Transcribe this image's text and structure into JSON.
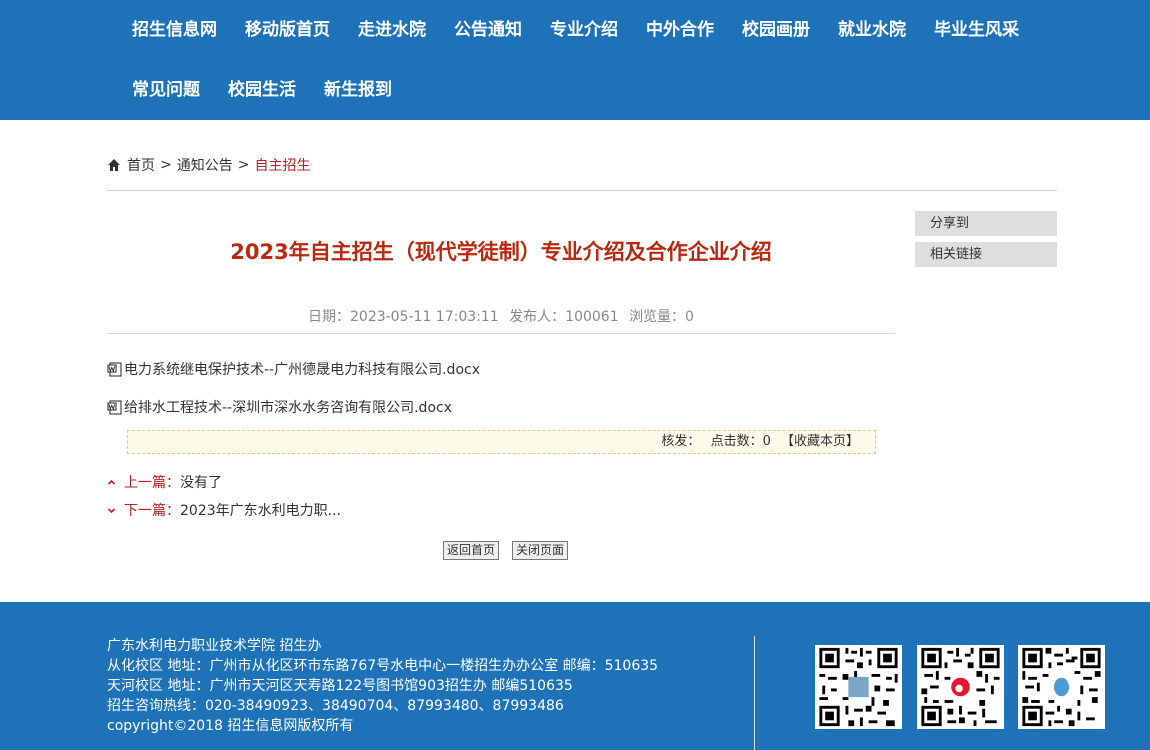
{
  "nav": {
    "row1": [
      "招生信息网",
      "移动版首页",
      "走进水院",
      "公告通知",
      "专业介绍",
      "中外合作",
      "校园画册",
      "就业水院",
      "毕业生风采"
    ],
    "row2": [
      "常见问题",
      "校园生活",
      "新生报到"
    ]
  },
  "breadcrumb": {
    "home": "首页",
    "sep1": ">",
    "section": "通知公告",
    "sep2": ">",
    "current": "自主招生"
  },
  "sidebar": {
    "share": "分享到",
    "links": "相关链接"
  },
  "article": {
    "title": "2023年自主招生（现代学徒制）专业介绍及合作企业介绍",
    "date": "日期：2023-05-11 17:03:11",
    "publisher": "发布人：100061",
    "views": "浏览量：0",
    "attachments": [
      "电力系统继电保护技术--广州德晟电力科技有限公司.docx",
      "给排水工程技术--深圳市深水水务咨询有限公司.docx"
    ],
    "info": {
      "approve": "核发：",
      "clicks": "点击数：0",
      "favorite": "【收藏本页】"
    },
    "prev": {
      "label": "上一篇：",
      "text": "没有了"
    },
    "next": {
      "label": "下一篇：",
      "text": "2023年广东水利电力职..."
    },
    "buttons": {
      "back": "返回首页",
      "close": "关闭页面"
    }
  },
  "footer": {
    "lines": [
      "广东水利电力职业技术学院 招生办",
      "从化校区 地址：广州市从化区环市东路767号水电中心一楼招生办办公室 邮编：510635",
      "天河校区 地址：广州市天河区天寿路122号图书馆903招生办 邮编510635",
      "招生咨询热线：020-38490923、38490704、87993480、87993486",
      "copyright©2018 招生信息网版权所有"
    ]
  },
  "colors": {
    "nav_bg": "#1d72b8",
    "title_red": "#b8290f",
    "accent_red": "#b22222",
    "side_box": "#dedede"
  }
}
